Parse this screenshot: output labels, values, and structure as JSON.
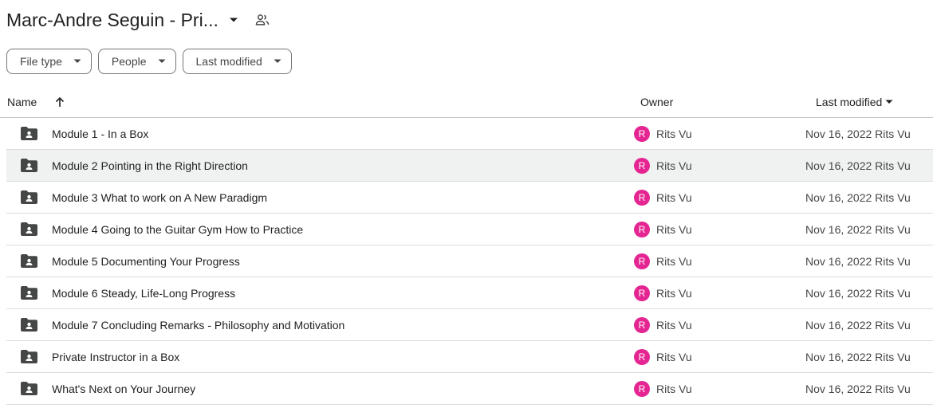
{
  "header": {
    "title": "Marc-Andre Seguin - Pri..."
  },
  "filters": [
    {
      "label": "File type"
    },
    {
      "label": "People"
    },
    {
      "label": "Last modified"
    }
  ],
  "columns": {
    "name": "Name",
    "owner": "Owner",
    "last_modified": "Last modified"
  },
  "rows": [
    {
      "name": "Module 1 - In a Box",
      "owner_initial": "R",
      "owner": "Rits Vu",
      "modified": "Nov 16, 2022 Rits Vu"
    },
    {
      "name": "Module 2 Pointing in the Right Direction",
      "owner_initial": "R",
      "owner": "Rits Vu",
      "modified": "Nov 16, 2022 Rits Vu"
    },
    {
      "name": "Module 3 What to work on A New Paradigm",
      "owner_initial": "R",
      "owner": "Rits Vu",
      "modified": "Nov 16, 2022 Rits Vu"
    },
    {
      "name": "Module 4 Going to the Guitar Gym How to Practice",
      "owner_initial": "R",
      "owner": "Rits Vu",
      "modified": "Nov 16, 2022 Rits Vu"
    },
    {
      "name": "Module 5 Documenting Your Progress",
      "owner_initial": "R",
      "owner": "Rits Vu",
      "modified": "Nov 16, 2022 Rits Vu"
    },
    {
      "name": "Module 6 Steady, Life-Long Progress",
      "owner_initial": "R",
      "owner": "Rits Vu",
      "modified": "Nov 16, 2022 Rits Vu"
    },
    {
      "name": "Module 7 Concluding Remarks - Philosophy and Motivation",
      "owner_initial": "R",
      "owner": "Rits Vu",
      "modified": "Nov 16, 2022 Rits Vu"
    },
    {
      "name": "Private Instructor in a Box",
      "owner_initial": "R",
      "owner": "Rits Vu",
      "modified": "Nov 16, 2022 Rits Vu"
    },
    {
      "name": "What's Next on Your Journey",
      "owner_initial": "R",
      "owner": "Rits Vu",
      "modified": "Nov 16, 2022 Rits Vu"
    }
  ],
  "colors": {
    "avatar": "#e52592",
    "row_hover": "#f0f2f1",
    "folder_icon": "#444746"
  },
  "icons": {
    "title_menu": "caret-down-icon",
    "shared": "people-icon",
    "sort": "arrow-up-icon",
    "folder": "shared-folder-icon"
  }
}
